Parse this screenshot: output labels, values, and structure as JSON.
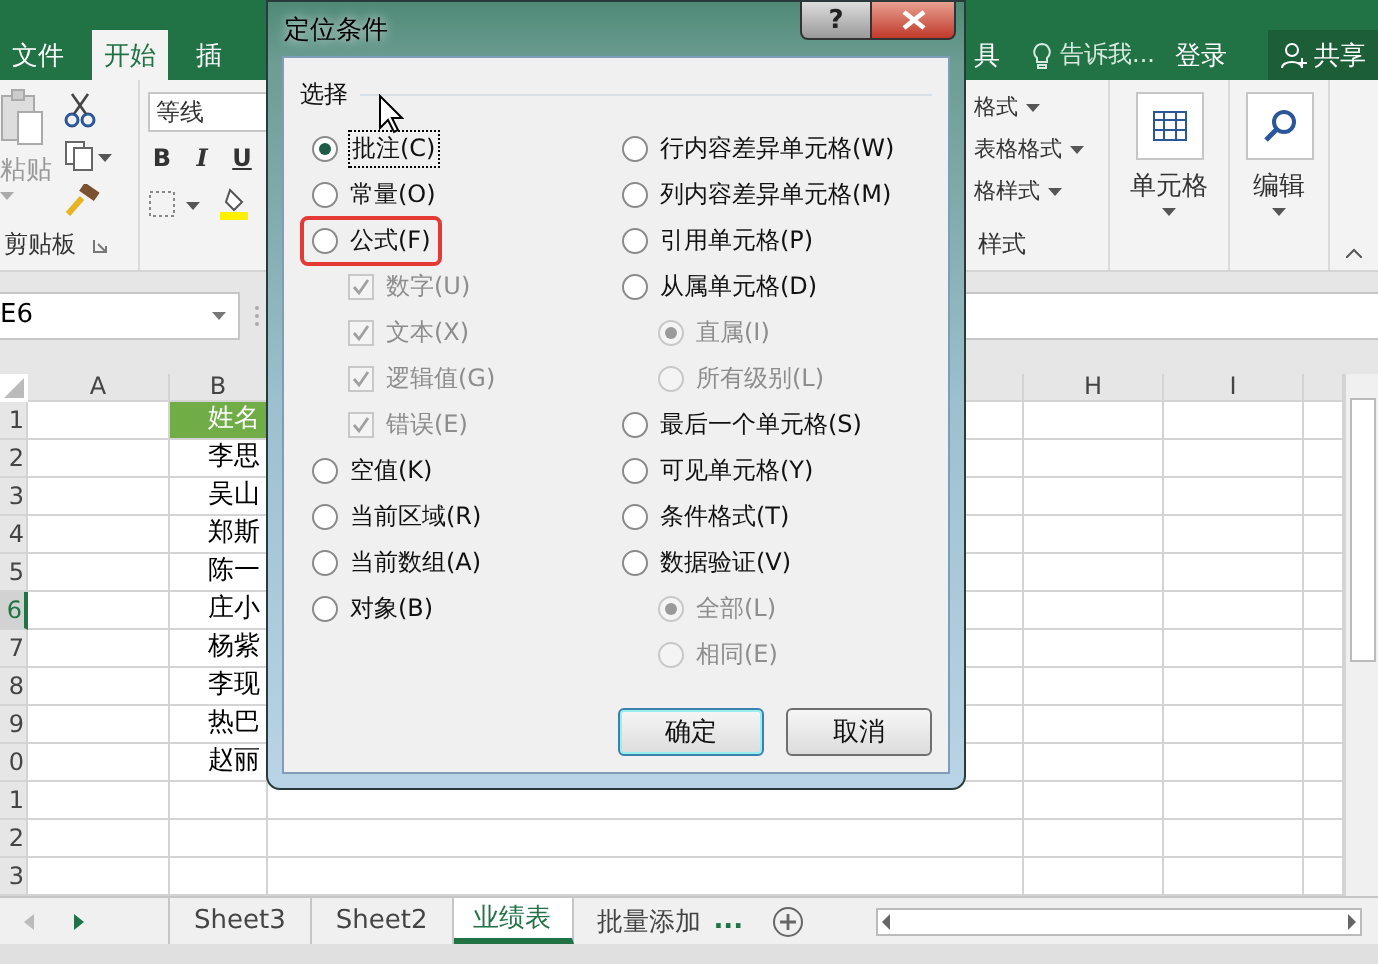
{
  "app": {
    "ribbon_tabs": [
      {
        "label": "文件",
        "selected": false
      },
      {
        "label": "开始",
        "selected": true
      },
      {
        "label": "插",
        "selected": false
      },
      {
        "label": "具",
        "selected": false
      }
    ],
    "tell_me": "告诉我...",
    "sign_in": "登录",
    "share": "共享"
  },
  "ribbon": {
    "paste_label": "粘贴",
    "clipboard_group": "剪贴板",
    "font_name": "等线",
    "font_buttons": [
      "B",
      "I",
      "U"
    ],
    "style_items": [
      "格式",
      "表格格式",
      "格样式"
    ],
    "styles_group": "样式",
    "cells": "单元格",
    "editing": "编辑"
  },
  "name_box": "E6",
  "sheet": {
    "columns": [
      "A",
      "B",
      "H",
      "I"
    ],
    "rows": [
      {
        "number": "1",
        "selected": false,
        "b": "姓名",
        "kind": "header"
      },
      {
        "number": "2",
        "selected": false,
        "b": "李思",
        "kind": "plain"
      },
      {
        "number": "3",
        "selected": false,
        "b": "吴山",
        "kind": "plain"
      },
      {
        "number": "4",
        "selected": false,
        "b": "郑斯",
        "kind": "plain"
      },
      {
        "number": "5",
        "selected": false,
        "b": "陈一",
        "kind": "plain"
      },
      {
        "number": "6",
        "selected": true,
        "b": "庄小",
        "kind": "plain"
      },
      {
        "number": "7",
        "selected": false,
        "b": "杨紫",
        "kind": "plain"
      },
      {
        "number": "8",
        "selected": false,
        "b": "李现",
        "kind": "plain"
      },
      {
        "number": "9",
        "selected": false,
        "b": "热巴",
        "kind": "plain"
      },
      {
        "number": "0",
        "selected": false,
        "b": "赵丽",
        "kind": "plain"
      },
      {
        "number": "1",
        "selected": false,
        "kind": "plain"
      },
      {
        "number": "2",
        "selected": false,
        "kind": "plain"
      },
      {
        "number": "3",
        "selected": false,
        "kind": "plain"
      }
    ]
  },
  "sheet_tabs": {
    "tabs": [
      {
        "label": "Sheet3",
        "selected": false
      },
      {
        "label": "Sheet2",
        "selected": false
      },
      {
        "label": "业绩表",
        "selected": true
      },
      {
        "label": "批量添加",
        "selected": false
      }
    ],
    "more": "..."
  },
  "dialog": {
    "title": "定位条件",
    "help": "?",
    "group_label": "选择",
    "left": [
      {
        "label": "批注(C)",
        "kind": "radio",
        "selected": true,
        "disabled": false,
        "highlighted": false
      },
      {
        "label": "常量(O)",
        "kind": "radio",
        "selected": false,
        "disabled": false,
        "highlighted": false
      },
      {
        "label": "公式(F)",
        "kind": "radio",
        "selected": false,
        "disabled": false,
        "highlighted": true,
        "children": [
          {
            "label": "数字(U)",
            "kind": "checkbox",
            "checked": true,
            "disabled": true
          },
          {
            "label": "文本(X)",
            "kind": "checkbox",
            "checked": true,
            "disabled": true
          },
          {
            "label": "逻辑值(G)",
            "kind": "checkbox",
            "checked": true,
            "disabled": true
          },
          {
            "label": "错误(E)",
            "kind": "checkbox",
            "checked": true,
            "disabled": true
          }
        ]
      },
      {
        "label": "空值(K)",
        "kind": "radio",
        "selected": false,
        "disabled": false,
        "highlighted": false
      },
      {
        "label": "当前区域(R)",
        "kind": "radio",
        "selected": false,
        "disabled": false,
        "highlighted": false
      },
      {
        "label": "当前数组(A)",
        "kind": "radio",
        "selected": false,
        "disabled": false,
        "highlighted": false
      },
      {
        "label": "对象(B)",
        "kind": "radio",
        "selected": false,
        "disabled": false,
        "highlighted": false
      }
    ],
    "right": [
      {
        "label": "行内容差异单元格(W)",
        "kind": "radio",
        "selected": false,
        "disabled": false,
        "highlighted": false
      },
      {
        "label": "列内容差异单元格(M)",
        "kind": "radio",
        "selected": false,
        "disabled": false,
        "highlighted": false
      },
      {
        "label": "引用单元格(P)",
        "kind": "radio",
        "selected": false,
        "disabled": false,
        "highlighted": false
      },
      {
        "label": "从属单元格(D)",
        "kind": "radio",
        "selected": false,
        "disabled": false,
        "highlighted": false,
        "children": [
          {
            "label": "直属(I)",
            "kind": "radio",
            "selected": true,
            "disabled": true
          },
          {
            "label": "所有级别(L)",
            "kind": "radio",
            "selected": false,
            "disabled": true
          }
        ]
      },
      {
        "label": "最后一个单元格(S)",
        "kind": "radio",
        "selected": false,
        "disabled": false,
        "highlighted": false
      },
      {
        "label": "可见单元格(Y)",
        "kind": "radio",
        "selected": false,
        "disabled": false,
        "highlighted": false
      },
      {
        "label": "条件格式(T)",
        "kind": "radio",
        "selected": false,
        "disabled": false,
        "highlighted": false
      },
      {
        "label": "数据验证(V)",
        "kind": "radio",
        "selected": false,
        "disabled": false,
        "highlighted": false,
        "children": [
          {
            "label": "全部(L)",
            "kind": "radio",
            "selected": true,
            "disabled": true
          },
          {
            "label": "相同(E)",
            "kind": "radio",
            "selected": false,
            "disabled": true
          }
        ]
      }
    ],
    "buttons": [
      {
        "label": "确定",
        "default": true
      },
      {
        "label": "取消",
        "default": false
      }
    ]
  }
}
